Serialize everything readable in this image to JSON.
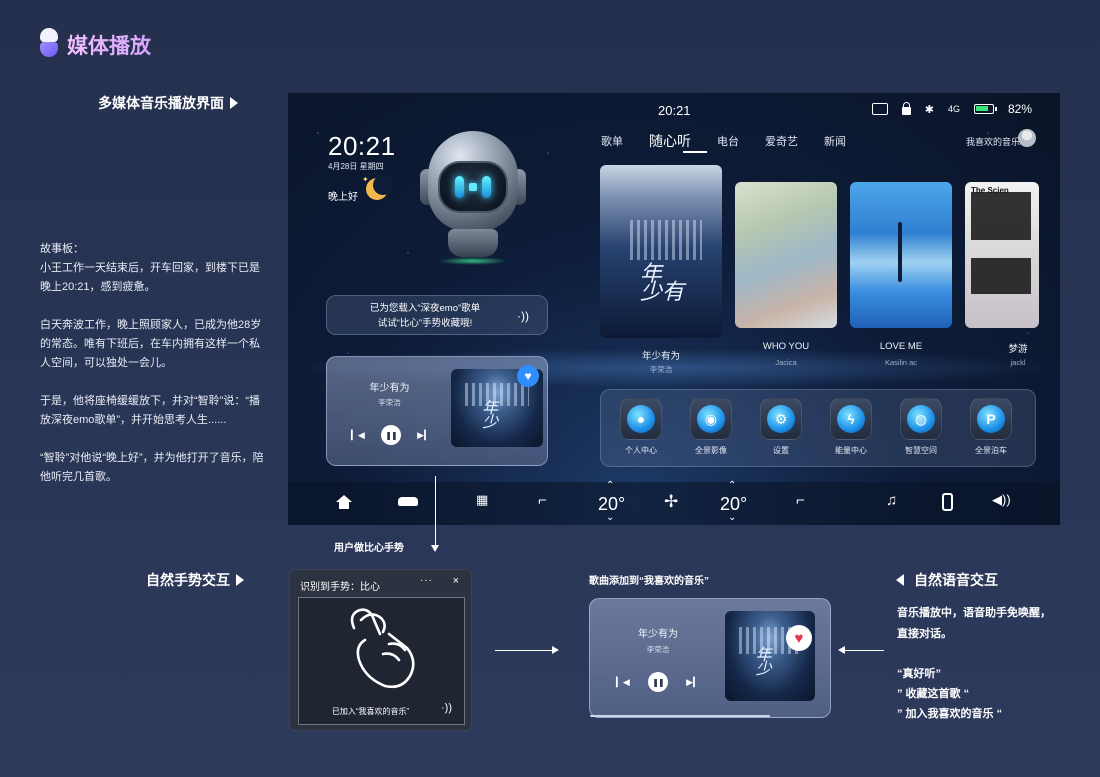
{
  "page": {
    "title": "媒体播放",
    "section_main": "多媒体音乐播放界面",
    "section_gesture": "自然手势交互",
    "section_voice": "自然语音交互"
  },
  "story": {
    "heading": "故事板：",
    "paragraphs": [
      "小王工作一天结束后，开车回家，到楼下已是晚上20:21，感到疲惫。",
      "白天奔波工作，晚上照顾家人，已成为他28岁的常态。唯有下班后，在车内拥有这样一个私人空间，可以独处一会儿。",
      "于是，他将座椅缓缓放下，并对“智聆”说：“播放深夜emo歌单”，并开始思考人生......",
      "“智聆”对他说“晚上好”，并为他打开了音乐，陪他听完几首歌。"
    ]
  },
  "screen": {
    "status": {
      "time": "20:21",
      "signal": "4G",
      "battery": "82%"
    },
    "clock": "20:21",
    "date": "4月28日 星期四",
    "greeting": "晚上好",
    "voice_bubble": {
      "line1": "已为您载入“深夜emo”歌单",
      "line2": "试试“比心”手势收藏哦!"
    },
    "tabs": [
      "歌单",
      "随心听",
      "电台",
      "爱奇艺",
      "新闻"
    ],
    "active_tab": "随心听",
    "favorites_link": "我喜欢的音乐",
    "albums": [
      {
        "title": "年少有为",
        "artist": "李荣浩"
      },
      {
        "title": "WHO YOU",
        "artist": "Jacica"
      },
      {
        "title": "LOVE ME",
        "artist": "Kasilin ac"
      },
      {
        "title": "梦游",
        "artist": "jackl"
      }
    ],
    "album_tag": "The Scien",
    "mini_player": {
      "title": "年少有为",
      "artist": "李荣浩"
    },
    "apps": [
      {
        "label": "个人中心",
        "icon": "user-icon"
      },
      {
        "label": "全景影像",
        "icon": "camera-icon"
      },
      {
        "label": "设置",
        "icon": "gear-icon"
      },
      {
        "label": "能量中心",
        "icon": "lightning-icon"
      },
      {
        "label": "智慧空间",
        "icon": "planet-icon"
      },
      {
        "label": "全景泊车",
        "icon": "parking-icon"
      }
    ],
    "dock": {
      "temp_left": "20°",
      "temp_right": "20°"
    }
  },
  "flow": {
    "gesture_step": "用户做比心手势",
    "added_step": "歌曲添加到“我喜欢的音乐”"
  },
  "gesture_window": {
    "title": "识别到手势：比心",
    "more": "···",
    "close": "×",
    "caption": "已加入“我喜欢的音乐”"
  },
  "player2": {
    "title": "年少有为",
    "artist": "李荣浩"
  },
  "voice": {
    "desc_line1": "音乐播放中，语音助手免唤醒，",
    "desc_line2": "直接对话。",
    "quotes": [
      "“真好听”",
      "” 收藏这首歌 “",
      "” 加入我喜欢的音乐 “"
    ]
  },
  "colors": {
    "accent": "#1d8fe8",
    "title_gradient": "#f2c0ff",
    "battery": "#3ce27a",
    "heart": "#e8344a"
  }
}
